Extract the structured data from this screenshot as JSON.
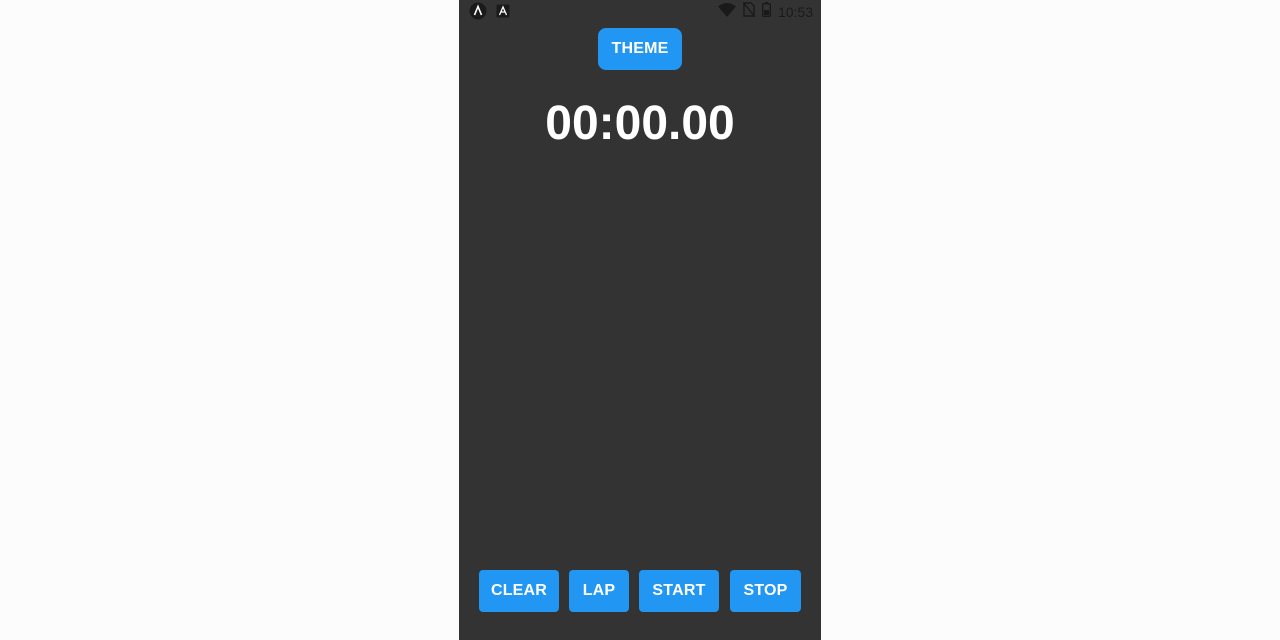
{
  "status_bar": {
    "left_icons": [
      "app-a-circle-icon",
      "app-a-square-icon"
    ],
    "right_icons": [
      "wifi-icon",
      "no-sim-icon",
      "battery-icon"
    ],
    "time": "10:53"
  },
  "header": {
    "theme_label": "THEME"
  },
  "timer": {
    "display": "00:00.00"
  },
  "controls": {
    "clear_label": "CLEAR",
    "lap_label": "LAP",
    "start_label": "START",
    "stop_label": "STOP"
  },
  "colors": {
    "background": "#333333",
    "accent": "#2196f3",
    "text": "#ffffff",
    "page": "#fcfcfc"
  }
}
